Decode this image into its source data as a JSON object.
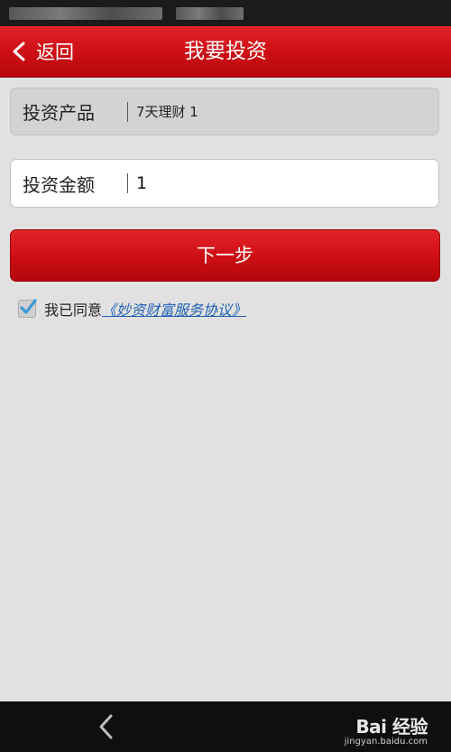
{
  "nav": {
    "back_label": "返回",
    "title": "我要投资"
  },
  "form": {
    "product_label": "投资产品",
    "product_value": "7天理财 1",
    "amount_label": "投资金额",
    "amount_value": "1"
  },
  "actions": {
    "next_label": "下一步"
  },
  "agreement": {
    "checked": true,
    "prefix": "我已同意",
    "link_text": "《妙资财富服务协议》"
  },
  "watermark": {
    "brand": "Bai 经验",
    "url": "jingyan.baidu.com"
  },
  "colors": {
    "accent_red": "#cc0e14",
    "link_blue": "#1f5fb5",
    "checkmark_blue": "#3a9ad9",
    "background": "#e1e1e1"
  }
}
